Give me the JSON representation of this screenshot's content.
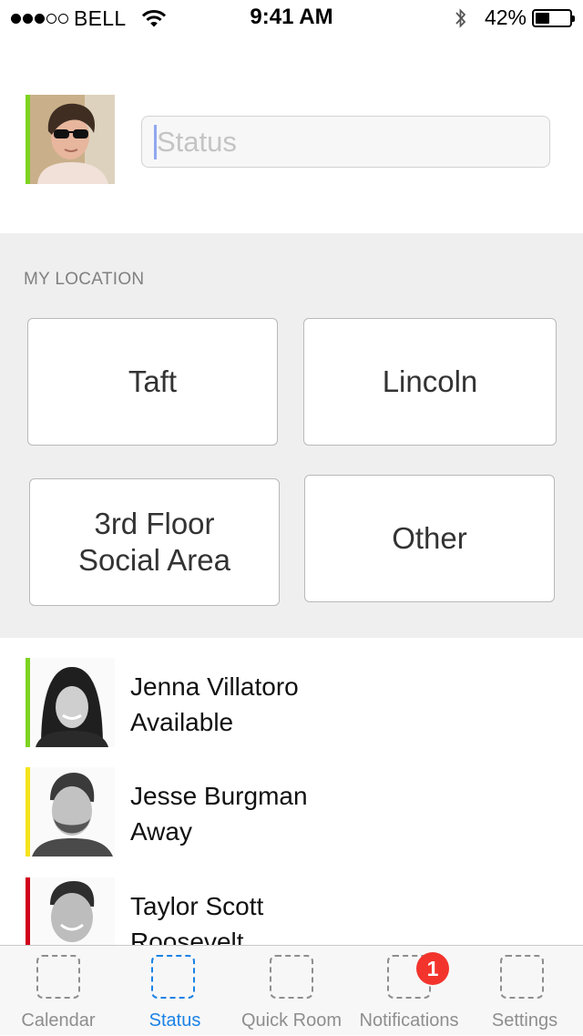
{
  "status_bar": {
    "carrier": "BELL",
    "signal_bars_filled": 3,
    "signal_bars_total": 5,
    "time": "9:41 AM",
    "battery_percent_label": "42%",
    "battery_level": 0.42
  },
  "profile": {
    "status_placeholder": "Status",
    "status_value": "",
    "presence_color": "#7ed321"
  },
  "location": {
    "section_title": "MY LOCATION",
    "options": [
      {
        "label": "Taft"
      },
      {
        "label": "Lincoln"
      },
      {
        "label": "3rd Floor\nSocial Area"
      },
      {
        "label": "Other"
      }
    ]
  },
  "people": [
    {
      "name": "Jenna Villatoro",
      "status": "Available",
      "presence_color": "#7ed321"
    },
    {
      "name": "Jesse Burgman",
      "status": "Away",
      "presence_color": "#f5e31a"
    },
    {
      "name": "Taylor Scott",
      "status": "Roosevelt",
      "presence_color": "#d0021b"
    }
  ],
  "tab_bar": {
    "tabs": [
      {
        "label": "Calendar",
        "active": false
      },
      {
        "label": "Status",
        "active": true
      },
      {
        "label": "Quick Room",
        "active": false
      },
      {
        "label": "Notifications",
        "active": false,
        "badge": "1"
      },
      {
        "label": "Settings",
        "active": false
      }
    ],
    "active_color": "#1a82e6",
    "inactive_color": "#8e8e8e",
    "badge_color": "#f2342d"
  }
}
